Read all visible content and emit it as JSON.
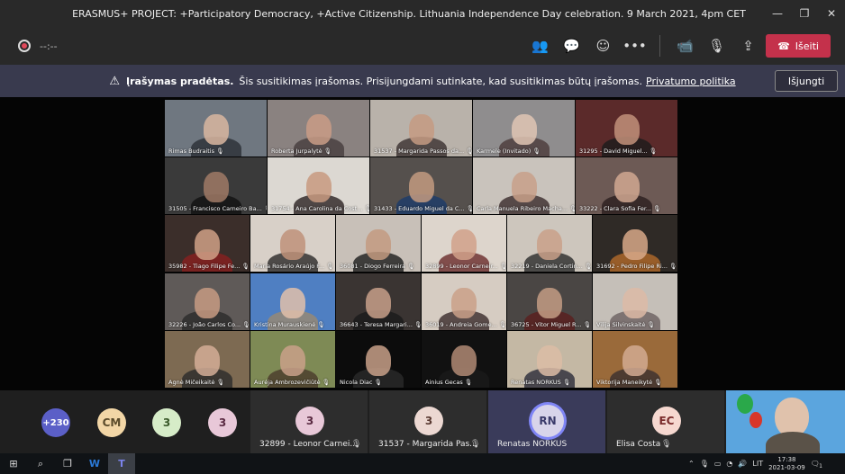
{
  "window": {
    "title": "ERASMUS+ PROJECT: +Participatory Democracy, +Active Citizenship. Lithuania Independence Day celebration. 9 March 2021, 4pm CET",
    "minimize": "—",
    "restore": "❐",
    "close": "✕"
  },
  "toolbar": {
    "timer": "--:--",
    "people_icon": "👥",
    "chat_icon": "💬",
    "reactions_icon": "☺",
    "more_icon": "•••",
    "camera_icon": "📹",
    "mic_icon": "🎙",
    "share_icon": "⇪",
    "leave_icon": "☎",
    "leave_label": "Išeiti",
    "leave_color": "#c4314b"
  },
  "banner": {
    "warning_icon": "⚠",
    "title": "Įrašymas pradėtas.",
    "text": "Šis susitikimas įrašomas. Prisijungdami sutinkate, kad susitikimas būtų įrašomas.",
    "link": "Privatumo politika",
    "button": "Išjungti"
  },
  "gallery_row1": [
    {
      "name": "Rimas Budraitis",
      "bg": "#6f7780",
      "face": "#d9b6a0",
      "body": "#2b2e35"
    },
    {
      "name": "Roberta Jurpalytė",
      "bg": "#8a8280",
      "face": "#c99c86",
      "body": "#453c3c"
    },
    {
      "name": "31537 - Margarida Passos da...",
      "bg": "#b9b2aa",
      "face": "#c49a83",
      "body": "#3a3030"
    },
    {
      "name": "Karmele (Invitado)",
      "bg": "#8f8d8e",
      "face": "#e0c6b4",
      "body": "#4a3a3a"
    },
    {
      "name": "31295 - David Miguel...",
      "bg": "#5b2a2a",
      "face": "#c2907a",
      "body": "#1c1c1c"
    }
  ],
  "gallery_row2": [
    {
      "name": "31505 - Francisco Carneiro Ba...",
      "bg": "#3a3a3a",
      "face": "#a07a66",
      "body": "#111"
    },
    {
      "name": "31754 - Ana Carolina da Cost...",
      "bg": "#dcd8d2",
      "face": "#c89a80",
      "body": "#2a2222"
    },
    {
      "name": "31433 - Eduardo Miguel da C...",
      "bg": "#55504d",
      "face": "#c39a80",
      "body": "#1b3b6a"
    },
    {
      "name": "Carla Manuela Ribeiro Macha...",
      "bg": "#c9c3bc",
      "face": "#c8a08a",
      "body": "#3a2a2a"
    },
    {
      "name": "33222 - Clara Sofia Fer...",
      "bg": "#6d5a55",
      "face": "#d1a892",
      "body": "#2a1e1e"
    }
  ],
  "gallery_row3": [
    {
      "name": "35982 - Tiago Filipe Fe...",
      "bg": "#3b2e2a",
      "face": "#d0a086",
      "body": "#8a1f1f"
    },
    {
      "name": "Maria Rosário Araújo F...",
      "bg": "#d8d0c8",
      "face": "#c0927a",
      "body": "#2a2828"
    },
    {
      "name": "36081 - Diogo Ferreira",
      "bg": "#c8c0b8",
      "face": "#c39a80",
      "body": "#1c1c1c"
    },
    {
      "name": "32899 - Leonor Carneir...",
      "bg": "#ddd5cc",
      "face": "#d1a18a",
      "body": "#6a2a2a"
    },
    {
      "name": "32219 - Daniela Cortin...",
      "bg": "#cdc6bd",
      "face": "#c9a08a",
      "body": "#2a2a2a"
    },
    {
      "name": "31692 - Pedro Filipe Ri...",
      "bg": "#2f2a26",
      "face": "#d7a888",
      "body": "#b36a2a"
    }
  ],
  "gallery_row4": [
    {
      "name": "32226 - João Carlos Co...",
      "bg": "#5f5a58",
      "face": "#c79b82",
      "body": "#2a2a2a"
    },
    {
      "name": "Kristina Murauskienė",
      "bg": "#4f7fc2",
      "face": "#e0c0aa",
      "body": "#9a8a70"
    },
    {
      "name": "36643 - Teresa Margari...",
      "bg": "#3a3432",
      "face": "#c8a08a",
      "body": "#1a1a1a"
    },
    {
      "name": "36019 - Andreia Gome...",
      "bg": "#d6ccc2",
      "face": "#caa088",
      "body": "#3a2a2a"
    },
    {
      "name": "36725 - Vitor Miguel R...",
      "bg": "#4a4644",
      "face": "#c39c84",
      "body": "#5a1e1e"
    },
    {
      "name": "Vilija Silvinskaitė",
      "bg": "#c5bfb8",
      "face": "#dcbaa6",
      "body": "#6a6060"
    }
  ],
  "gallery_row5": [
    {
      "name": "Agnė Mičeikaitė",
      "bg": "#7d6a52",
      "face": "#d4ad96",
      "body": "#2a2a2a"
    },
    {
      "name": "Aurėja Ambrozevičiūtė",
      "bg": "#7e8a55",
      "face": "#c9a08a",
      "body": "#4a3a2a"
    },
    {
      "name": "Nicola Diac",
      "bg": "#0c0c0c",
      "face": "#c8a088",
      "body": "#2a2a2a"
    },
    {
      "name": "Ainius Gecas",
      "bg": "#111111",
      "face": "#b08a74",
      "body": "#1a1a1a"
    },
    {
      "name": "Renatas NORKUS",
      "bg": "#c4b8a4",
      "face": "#dcbca6",
      "body": "#2a2a38"
    },
    {
      "name": "Viktorija Maneikytė",
      "bg": "#9a6a3a",
      "face": "#d2aa92",
      "body": "#3a3030"
    }
  ],
  "bottom": {
    "overflow": "+230",
    "avatar_cm": "CM",
    "avatar_3a": "3",
    "avatar_3b": "3",
    "tile1_initial": "3",
    "tile1_name": "32899 - Leonor Carnei...",
    "tile2_initial": "3",
    "tile2_name": "31537 - Margarida Pas...",
    "tile3_initial": "RN",
    "tile3_name": "Renatas NORKUS",
    "tile4_initial": "EC",
    "tile4_name": "Elisa Costa",
    "muted_icon": "🎙"
  },
  "taskbar": {
    "start_icon": "⊞",
    "search_icon": "⌕",
    "taskview_icon": "❐",
    "word_icon": "W",
    "teams_icon": "T",
    "tray_chevron": "⌃",
    "lang": "LIT",
    "time": "17:38",
    "date": "2021-03-09",
    "notif_icon": "🗨",
    "notif_count": "1"
  }
}
